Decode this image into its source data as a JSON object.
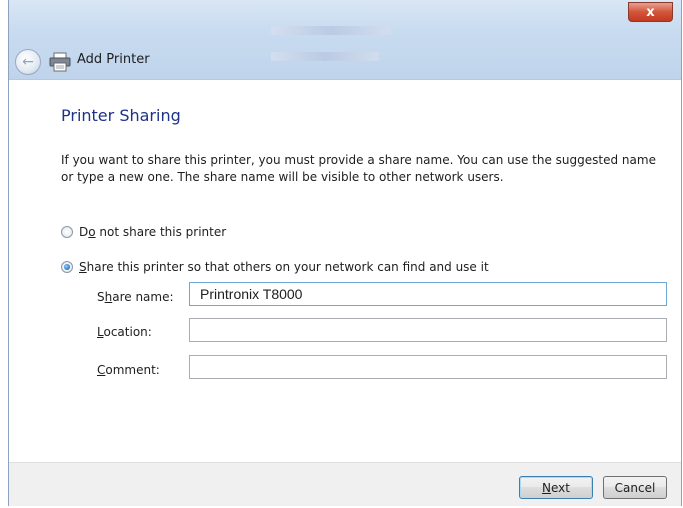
{
  "window": {
    "close_glyph": "x"
  },
  "nav": {
    "title": "Add Printer",
    "back_icon": "back-arrow-icon",
    "printer_icon": "printer-icon"
  },
  "page": {
    "heading": "Printer Sharing",
    "instruction": "If you want to share this printer, you must provide a share name. You can use the suggested name or type a new one. The share name will be visible to other network users."
  },
  "options": {
    "no_share": {
      "pre": "D",
      "accel": "o",
      "post": " not share this printer",
      "checked": false
    },
    "share": {
      "pre": "",
      "accel": "S",
      "post": "hare this printer so that others on your network can find and use it",
      "checked": true
    }
  },
  "fields": {
    "share_name": {
      "pre": "S",
      "accel": "h",
      "post": "are name:",
      "value": "Printronix T8000"
    },
    "location": {
      "pre": "",
      "accel": "L",
      "post": "ocation:",
      "value": ""
    },
    "comment": {
      "pre": "",
      "accel": "C",
      "post": "omment:",
      "value": ""
    }
  },
  "buttons": {
    "next": {
      "pre": "",
      "accel": "N",
      "post": "ext"
    },
    "cancel": "Cancel"
  },
  "colors": {
    "heading": "#1e3287",
    "close_button": "#c43a1f",
    "footer": "#f0f0f0"
  }
}
